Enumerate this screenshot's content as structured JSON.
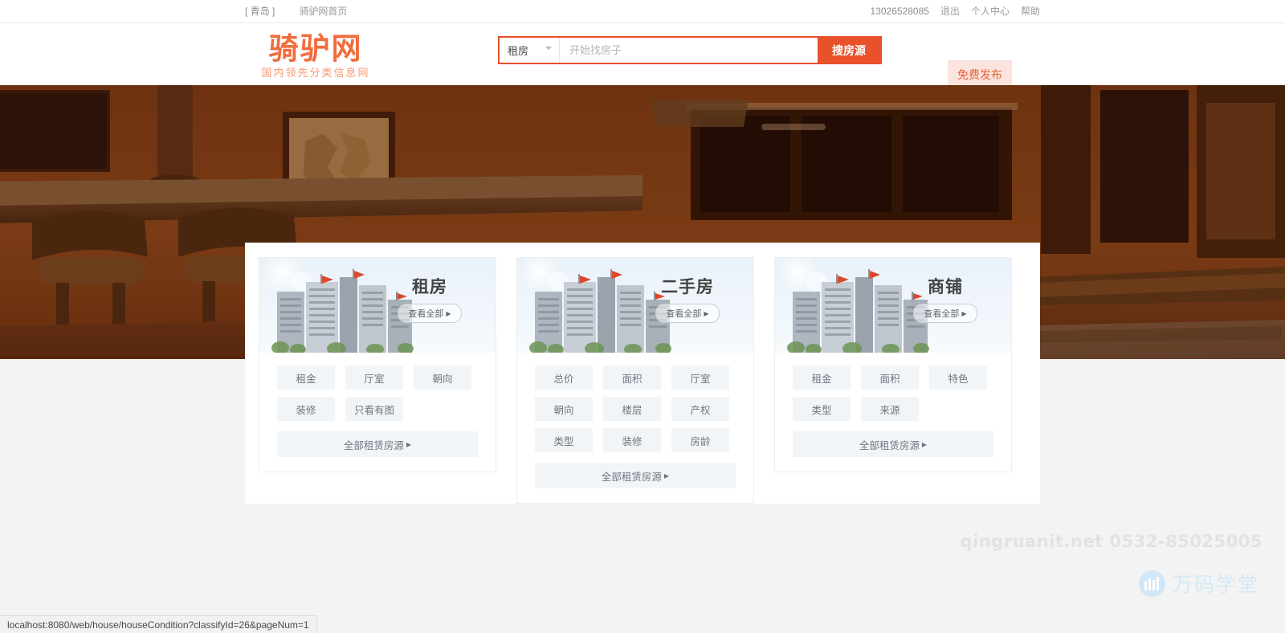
{
  "topbar": {
    "city": "[ 青岛 ]",
    "home_link": "骑驴网首页",
    "phone": "13026528085",
    "logout": "退出",
    "user_center": "个人中心",
    "help": "帮助"
  },
  "header": {
    "logo_main": "骑驴网",
    "logo_sub": "国内领先分类信息网",
    "search": {
      "category_selected": "租房",
      "placeholder": "开始找房子",
      "value": "",
      "button_label": "搜房源"
    },
    "publish_label": "免费发布"
  },
  "cards": [
    {
      "title": "租房",
      "view_all": "查看全部",
      "tags": [
        "租金",
        "厅室",
        "朝向",
        "装修",
        "只看有图"
      ],
      "all_label": "全部租赁房源"
    },
    {
      "title": "二手房",
      "view_all": "查看全部",
      "tags": [
        "总价",
        "面积",
        "厅室",
        "朝向",
        "楼层",
        "产权",
        "类型",
        "装修",
        "房龄"
      ],
      "all_label": "全部租赁房源"
    },
    {
      "title": "商铺",
      "view_all": "查看全部",
      "tags": [
        "租金",
        "面积",
        "特色",
        "类型",
        "来源"
      ],
      "all_label": "全部租赁房源"
    }
  ],
  "watermark": {
    "site_phone": "qingruanit.net 0532-85025005",
    "brand": "万码学堂"
  },
  "statusbar": {
    "url": "localhost:8080/web/house/houseCondition?classifyId=26&pageNum=1"
  },
  "icons": {
    "chevron": "chevron-down-icon",
    "triangle": "▶"
  },
  "colors": {
    "accent": "#e8512a",
    "logo": "#f26c3d",
    "publish_bg": "#fbe4dd",
    "tag_bg": "#f2f5f8",
    "page_bg": "#f3f3f3"
  }
}
